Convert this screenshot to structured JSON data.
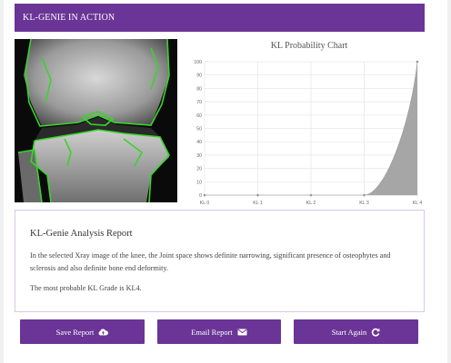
{
  "header": {
    "title": "KL-GENIE IN ACTION"
  },
  "xray": {
    "alt": "knee x-ray with highlighted joint contours"
  },
  "chart_data": {
    "type": "area",
    "title": "KL Probability Chart",
    "categories": [
      "KL 0",
      "KL 1",
      "KL 2",
      "KL 3",
      "KL 4"
    ],
    "series": [
      {
        "values": [
          0,
          0,
          0,
          0,
          100
        ]
      }
    ],
    "yticks": [
      0,
      10,
      20,
      30,
      40,
      50,
      60,
      70,
      80,
      90,
      100
    ],
    "ylim": [
      0,
      100
    ],
    "grid": true,
    "fill_color": "#a6a6a6"
  },
  "report": {
    "title": "KL-Genie Analysis Report",
    "paragraph1": "In the selected Xray image of the knee, the Joint space shows definite narrowing, significant presence of osteophytes and sclerosis and also definite bone end deformity.",
    "paragraph2": "The most probable KL Grade is KL4."
  },
  "buttons": {
    "save_label": "Save Report",
    "save_icon": "cloud-upload-icon",
    "email_label": "Email Report",
    "email_icon": "envelope-icon",
    "restart_label": "Start Again",
    "restart_icon": "refresh-icon"
  },
  "colors": {
    "accent": "#6a3596",
    "contour": "#39d42a"
  }
}
